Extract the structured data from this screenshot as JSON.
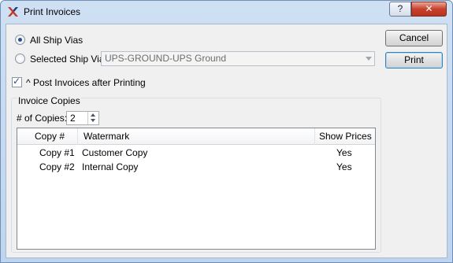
{
  "window": {
    "title": "Print Invoices",
    "help_label": "?",
    "close_label": "✕"
  },
  "ship_via": {
    "all_label": "All Ship Vias",
    "all_selected": true,
    "selected_label": "Selected Ship Via",
    "selected_value": "UPS-GROUND-UPS Ground"
  },
  "buttons": {
    "cancel": "Cancel",
    "print": "Print"
  },
  "post_invoices": {
    "label": "^ Post Invoices after Printing",
    "checked": true
  },
  "invoice_copies": {
    "group_title": "Invoice Copies",
    "copies_label": "# of Copies:",
    "copies_value": "2",
    "columns": [
      "Copy #",
      "Watermark",
      "Show Prices"
    ],
    "rows": [
      {
        "copy": "Copy #1",
        "watermark": "Customer Copy",
        "show_prices": "Yes"
      },
      {
        "copy": "Copy #2",
        "watermark": "Internal Copy",
        "show_prices": "Yes"
      }
    ]
  },
  "icons": {
    "app": "app-x-logo-icon",
    "checkmark": "checkmark-icon"
  },
  "colors": {
    "titlebar": "#cfe0f3",
    "close_button": "#c7402c",
    "dialog_bg": "#f0f0f0",
    "accent": "#2b4f8e"
  }
}
